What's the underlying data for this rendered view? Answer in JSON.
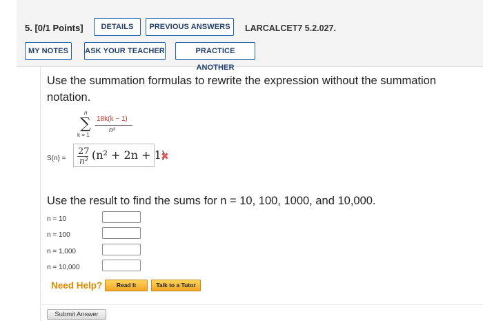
{
  "header": {
    "question_number": "5.",
    "points": "[0/1 Points]",
    "details_label": "DETAILS",
    "previous_answers_label": "PREVIOUS ANSWERS",
    "problem_code": "LARCALCET7 5.2.027.",
    "my_notes_label": "MY NOTES",
    "ask_teacher_label": "ASK YOUR TEACHER",
    "practice_another_label": "PRACTICE ANOTHER"
  },
  "question": {
    "prompt": "Use the summation formulas to rewrite the expression without the summation notation.",
    "summation": {
      "upper_limit": "n",
      "lower_limit": "k = 1",
      "numerator": "18k(k − 1)",
      "denominator": "n³"
    },
    "sn_label": "S(n) =",
    "answer": {
      "coefficient_numerator": "27",
      "coefficient_denominator": "n³",
      "expression": "(n² + 2n + 1)"
    },
    "incorrect_mark": "✖"
  },
  "part2": {
    "prompt": "Use the result to find the sums for n = 10, 100, 1000, and 10,000.",
    "rows": [
      {
        "label": "n = 10",
        "value": ""
      },
      {
        "label": "n = 100",
        "value": ""
      },
      {
        "label": "n = 1,000",
        "value": ""
      },
      {
        "label": "n = 10,000",
        "value": ""
      }
    ]
  },
  "help": {
    "need_help_label": "Need Help?",
    "read_it_label": "Read It",
    "talk_tutor_label": "Talk to a Tutor"
  },
  "submit_label": "Submit Answer",
  "colors": {
    "accent_blue": "#1f5ea8",
    "help_orange": "#e08a00",
    "incorrect_red": "#e05555",
    "summand_red": "#c0392b"
  }
}
